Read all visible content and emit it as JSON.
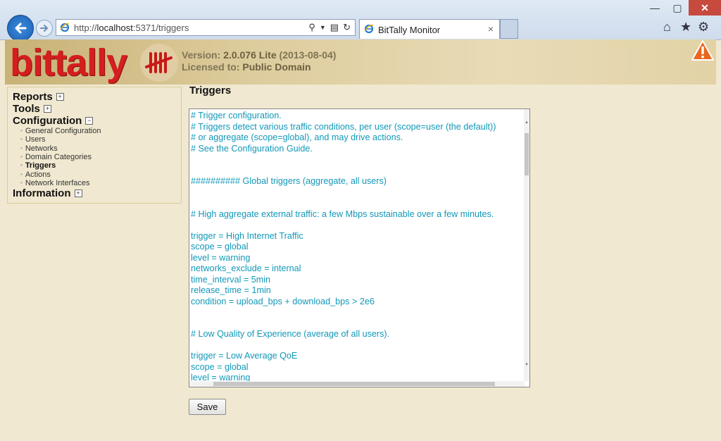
{
  "browser": {
    "url_prefix": "http://",
    "url_host": "localhost",
    "url_rest": ":5371/triggers",
    "tab_title": "BitTally Monitor",
    "tab_close": "×",
    "window_controls": [
      "—",
      "▢",
      "✕"
    ]
  },
  "header": {
    "logo_text": "bittally",
    "version_label": "Version:",
    "version_value": "2.0.076 Lite",
    "version_date": "(2013-08-04)",
    "license_label": "Licensed to:",
    "license_value": "Public Domain"
  },
  "sidebar": {
    "reports": "Reports",
    "tools": "Tools",
    "configuration": "Configuration",
    "information": "Information",
    "config_items": [
      "General Configuration",
      "Users",
      "Networks",
      "Domain Categories",
      "Triggers",
      "Actions",
      "Network Interfaces"
    ],
    "expand_symbol": "+",
    "collapse_symbol": "−"
  },
  "main": {
    "title": "Triggers",
    "save_label": "Save",
    "lines": [
      "# Trigger configuration.",
      "# Triggers detect various traffic conditions, per user (scope=user (the default))",
      "# or aggregate (scope=global), and may drive actions.",
      "# See the Configuration Guide.",
      "",
      "",
      "########## Global triggers (aggregate, all users)",
      "",
      "",
      "# High aggregate external traffic: a few Mbps sustainable over a few minutes.",
      "",
      "trigger = High Internet Traffic",
      "scope = global",
      "level = warning",
      "networks_exclude = internal",
      "time_interval = 5min",
      "release_time = 1min",
      "condition = upload_bps + download_bps > 2e6",
      "",
      "",
      "# Low Quality of Experience (average of all users).",
      "",
      "trigger = Low Average QoE",
      "scope = global",
      "level = warning"
    ]
  },
  "colors": {
    "code_text": "#1198b8",
    "logo_red": "#d51e1e",
    "page_bg": "#f0e8d0"
  }
}
